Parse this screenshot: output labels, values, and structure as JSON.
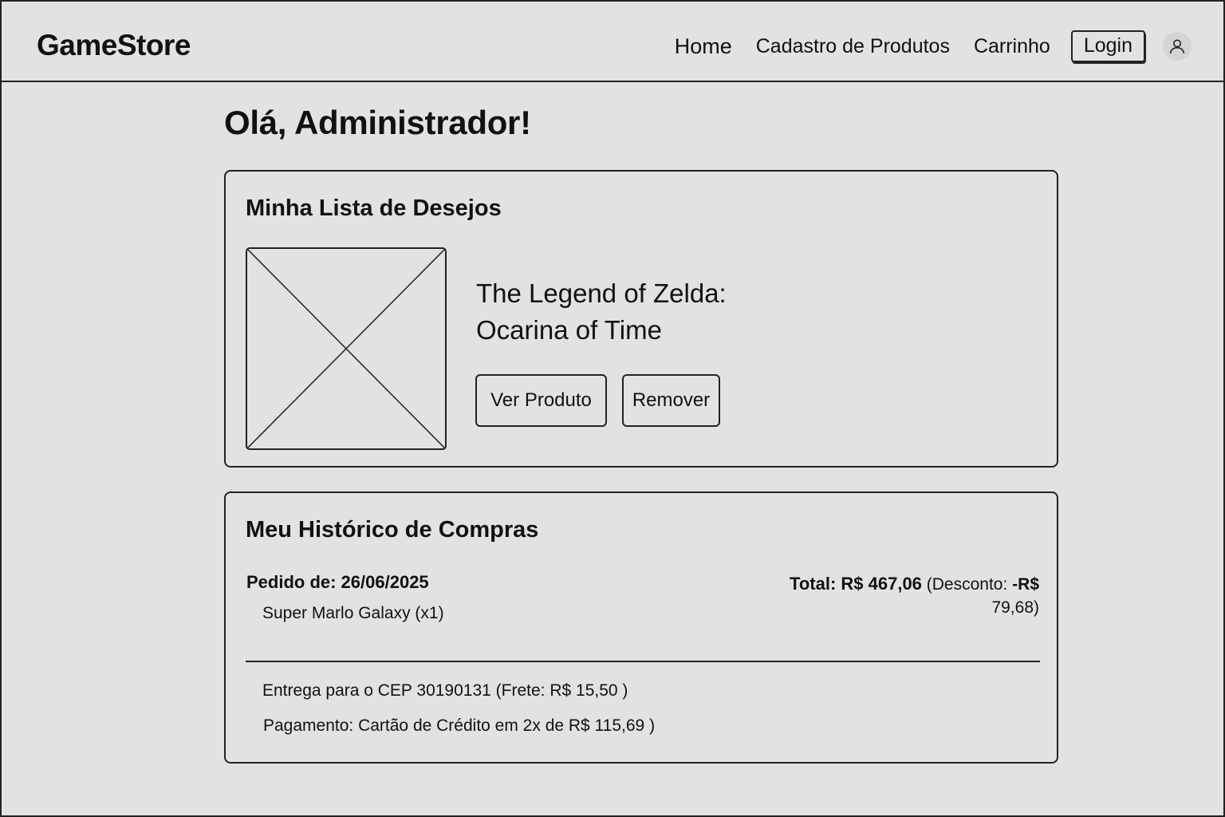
{
  "header": {
    "brand": "GameStore",
    "nav": {
      "home": "Home",
      "product_registration": "Cadastro de Produtos",
      "cart": "Carrinho",
      "login": "Login"
    },
    "user_icon": "user-icon"
  },
  "greeting": "Olá, Administrador!",
  "wishlist": {
    "title": "Minha Lista de Desejos",
    "image_icon": "image-placeholder-icon",
    "item": {
      "title_line1": "The Legend of Zelda:",
      "title_line2": "Ocarina of Time",
      "view_button": "Ver Produto",
      "remove_button": "Remover"
    }
  },
  "purchase_history": {
    "title": "Meu Histórico de Compras",
    "order": {
      "date_label": "Pedido de: 26/06/2025",
      "item": "Super Marlo Galaxy (x1)",
      "total_label": "Total: R$ 467,06",
      "discount_prefix": "(Desconto:",
      "discount_value": "-R$",
      "discount_amount": "79,68)",
      "delivery": "Entrega para o CEP 30190131 (Frete: R$ 15,50 )",
      "payment": "Pagamento: Cartão de Crédito em 2x de R$ 115,69 )"
    }
  }
}
